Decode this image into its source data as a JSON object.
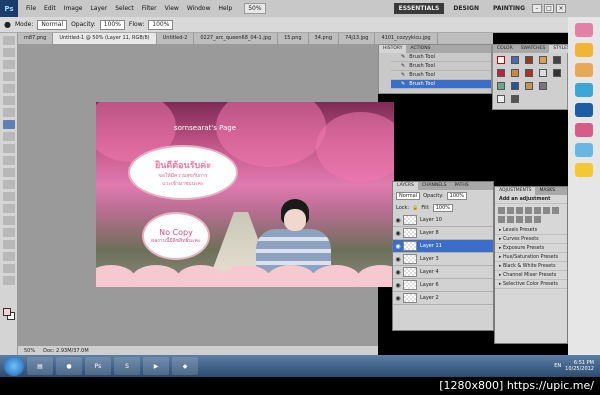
{
  "app": {
    "logo": "Ps",
    "menu": [
      "File",
      "Edit",
      "Image",
      "Layer",
      "Select",
      "Filter",
      "View",
      "Window",
      "Help"
    ],
    "zoom": "50%",
    "workspaces": [
      "ESSENTIALS",
      "DESIGN",
      "PAINTING"
    ]
  },
  "options": {
    "mode_label": "Mode:",
    "mode_value": "Normal",
    "opacity_label": "Opacity:",
    "opacity_value": "100%",
    "flow_label": "Flow:",
    "flow_value": "100%"
  },
  "doc_tabs": [
    "m87.png",
    "Untitled-1 @ 50% (Layer 11, RGB/8)",
    "Untitled-2",
    "0227_arc_queen68_04-1.jpg",
    "15.png",
    "34.png",
    "74j13.jpg",
    "4101_cozyykicu.jpg"
  ],
  "canvas": {
    "header": "sornsearat's Page",
    "bubble1_big": "ยินดีต้อนรับค่ะ",
    "bubble1_small1": "ขอให้มีความสุขกับการ",
    "bubble1_small2": "แวะเข้ามาชมนะคะ",
    "bubble2_big": "No Copy",
    "bubble2_small": "ผลงานนี้มีลิขสิทธิ์นะคะ"
  },
  "history": {
    "tabs": [
      "HISTORY",
      "ACTIONS"
    ],
    "rows": [
      "Brush Tool",
      "Brush Tool",
      "Brush Tool",
      "Brush Tool"
    ]
  },
  "color_panel": {
    "tabs": [
      "COLOR",
      "SWATCHES",
      "STYLES"
    ]
  },
  "layers": {
    "tabs": [
      "LAYERS",
      "CHANNELS",
      "PATHS"
    ],
    "mode": "Normal",
    "opacity_label": "Opacity:",
    "opacity_value": "100%",
    "lock_label": "Lock:",
    "fill_label": "Fill:",
    "fill_value": "100%",
    "rows": [
      "Layer 10",
      "Layer 8",
      "Layer 11",
      "Layer 3",
      "Layer 4",
      "Layer 6",
      "Layer 2"
    ],
    "selected_index": 2
  },
  "adjustments": {
    "tabs": [
      "ADJUSTMENTS",
      "MASKS"
    ],
    "title": "Add an adjustment",
    "presets": [
      "Levels Presets",
      "Curves Presets",
      "Exposure Presets",
      "Hue/Saturation Presets",
      "Black & White Presets",
      "Channel Mixer Presets",
      "Selective Color Presets"
    ]
  },
  "status": {
    "zoom": "50%",
    "doc": "Doc: 2.93M/37.0M"
  },
  "taskbar": {
    "lang": "EN",
    "time": "6:51 PM",
    "date": "10/25/2012"
  },
  "watermark": "[1280x800] https://upic.me/"
}
